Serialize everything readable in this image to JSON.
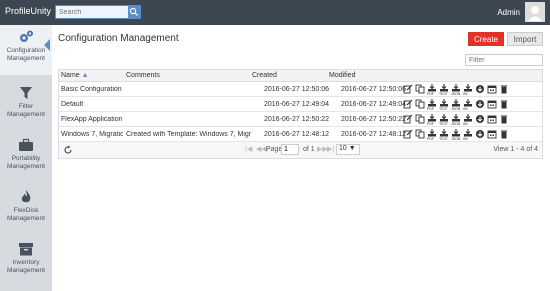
{
  "topbar": {
    "brand": "ProfileUnity",
    "search_placeholder": "Search",
    "user": "Admin"
  },
  "sidebar": {
    "items": [
      {
        "label1": "Configuration",
        "label2": "Management",
        "icon": "gears-icon"
      },
      {
        "label1": "Filter",
        "label2": "Management",
        "icon": "filter-icon"
      },
      {
        "label1": "Portability",
        "label2": "Management",
        "icon": "briefcase-icon"
      },
      {
        "label1": "FlexDisk",
        "label2": "Management",
        "icon": "flame-icon"
      },
      {
        "label1": "Inventory",
        "label2": "Management",
        "icon": "archive-icon"
      }
    ]
  },
  "main": {
    "title": "Configuration Management",
    "create_label": "Create",
    "import_label": "Import",
    "filter_placeholder": "Filter",
    "columns": {
      "name": "Name",
      "comments": "Comments",
      "created": "Created",
      "modified": "Modified"
    },
    "rows": [
      {
        "name": "Basic Configuration",
        "comments": "",
        "created": "2016-06-27 12:50:06",
        "modified": "2016-06-27 12:50:06"
      },
      {
        "name": "Default",
        "comments": "",
        "created": "2016-06-27 12:49:04",
        "modified": "2016-06-27 12:49:04"
      },
      {
        "name": "FlexApp Application...",
        "comments": "",
        "created": "2016-06-27 12:50:22",
        "modified": "2016-06-27 12:50:22"
      },
      {
        "name": "Windows 7, Migratio...",
        "comments": "Created with Template: Windows 7, Migra...",
        "created": "2016-06-27 12:48:12",
        "modified": "2016-06-27 12:48:12"
      }
    ],
    "download_labels": [
      "PDF",
      "TEXT",
      "JSON",
      "INI"
    ],
    "pager": {
      "page_label": "Page",
      "page_value": "1",
      "of_label": "of 1",
      "per_page": "10",
      "view_text": "View 1 - 4 of 4"
    }
  },
  "colors": {
    "accent": "#5a8fc8",
    "create": "#e0312a",
    "topbar": "#3c4752"
  }
}
